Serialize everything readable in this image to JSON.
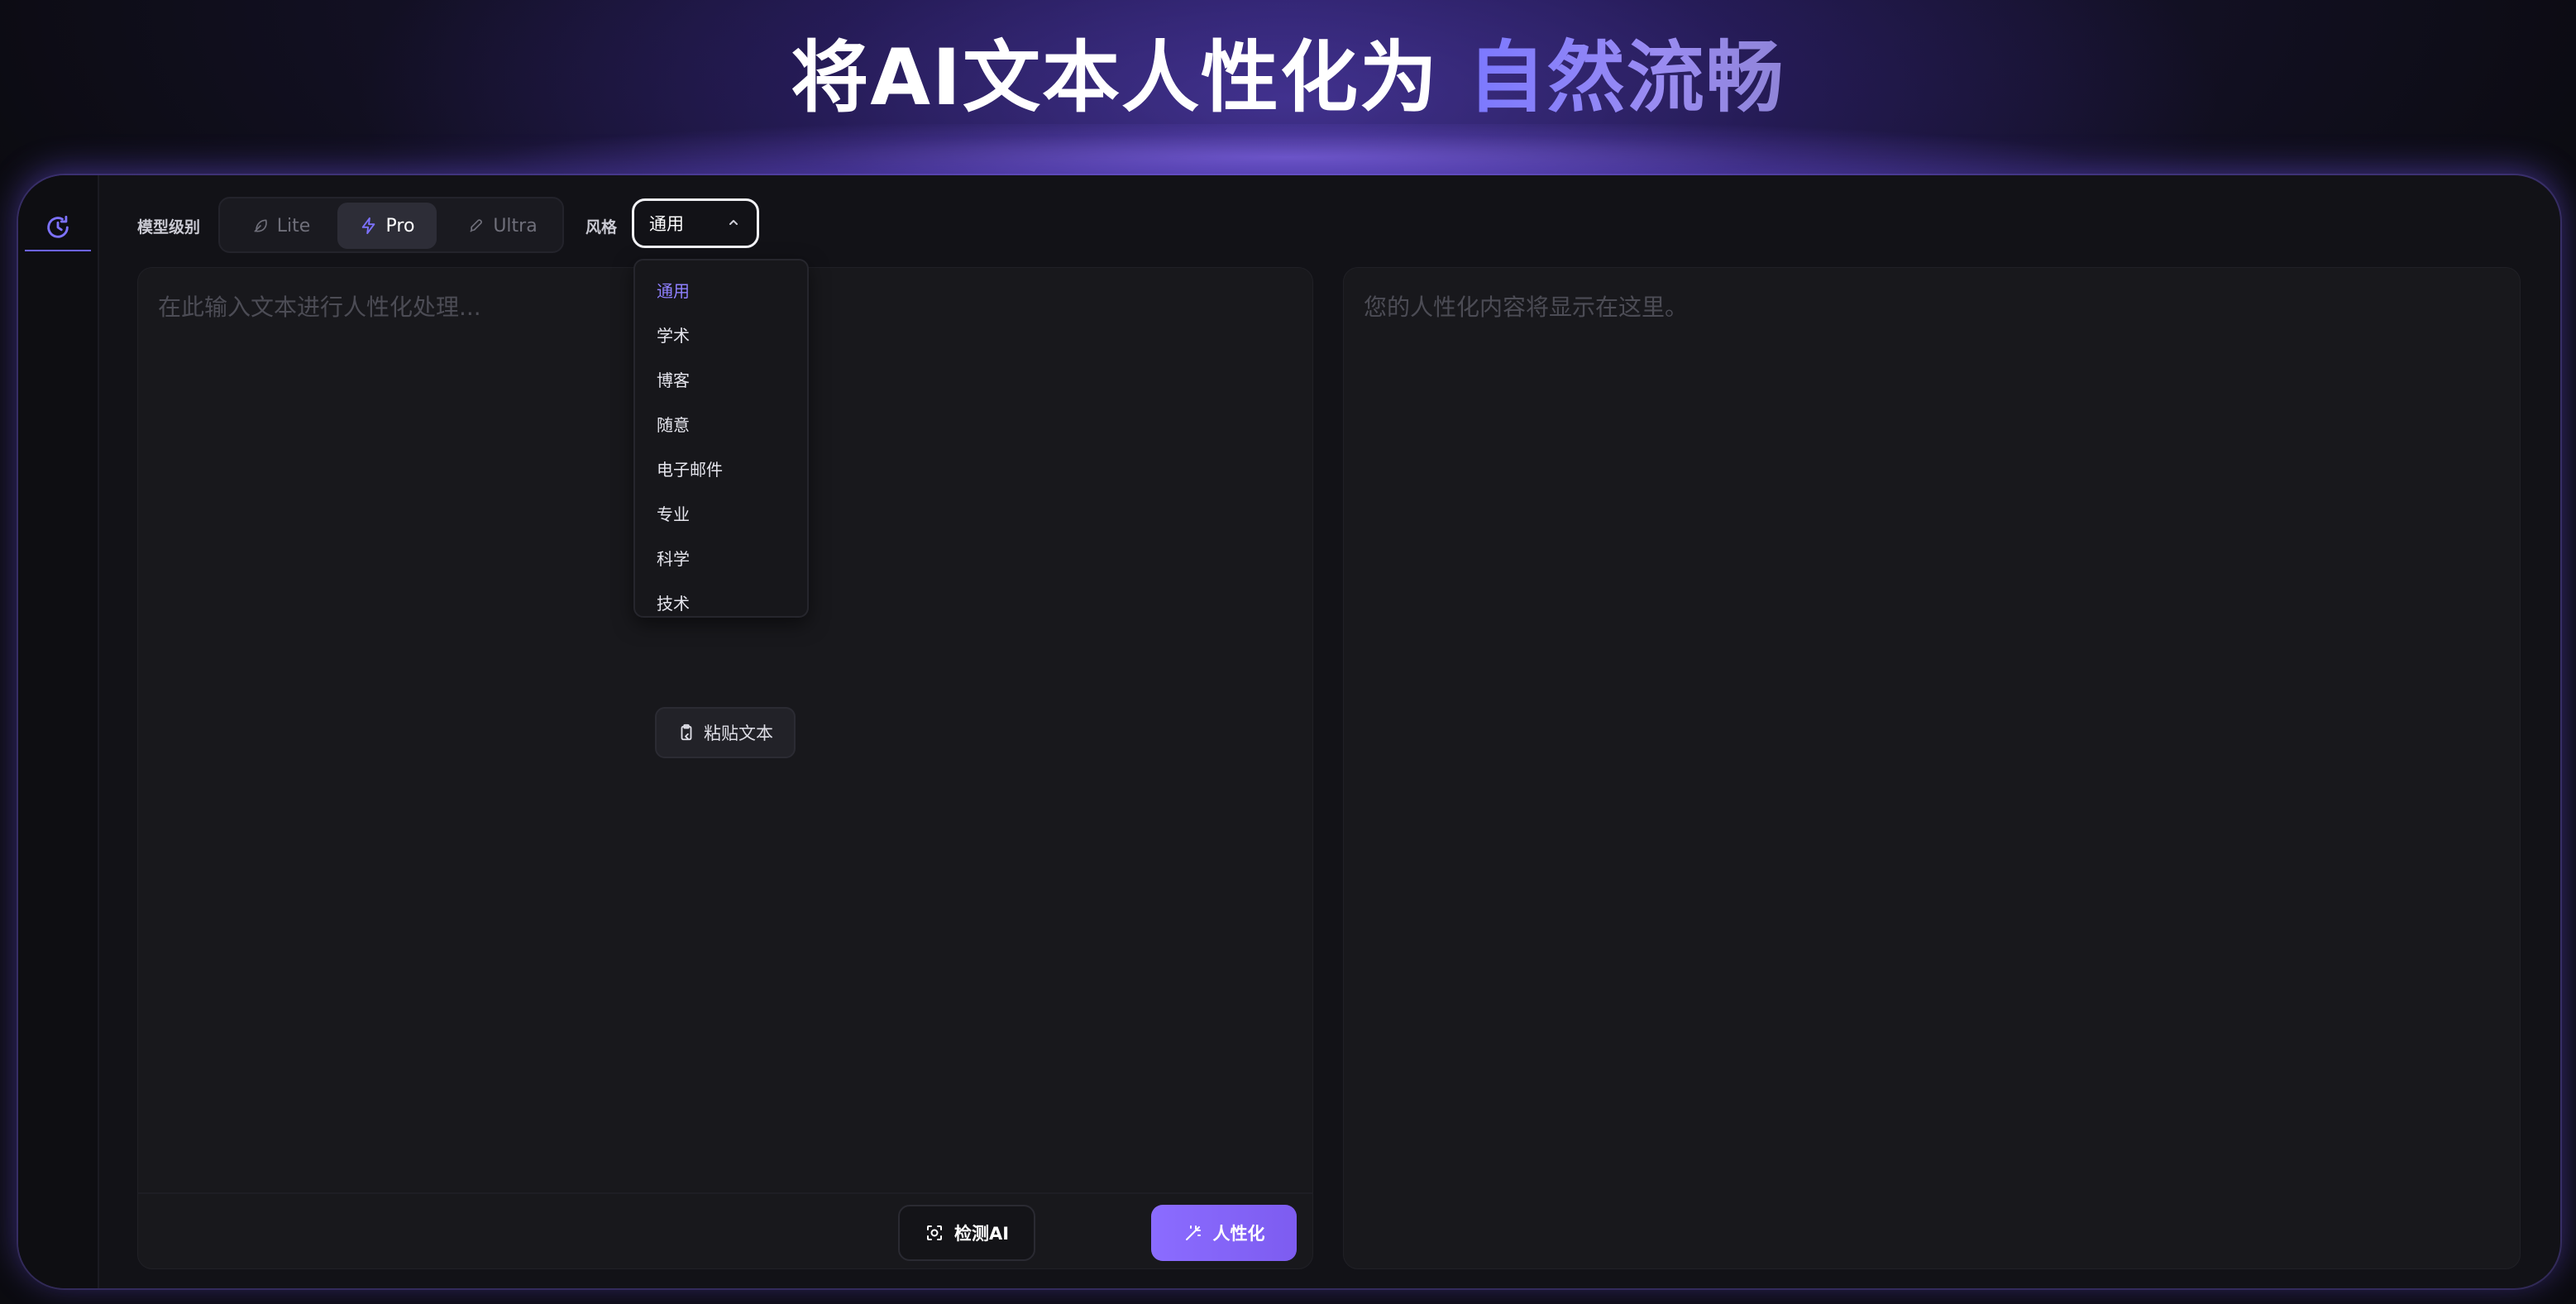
{
  "hero": {
    "title_main": "将AI文本人性化为 ",
    "title_accent": "自然流畅"
  },
  "toolbar": {
    "model_level_label": "模型级别",
    "tiers": [
      {
        "label": "Lite",
        "icon": "feather-icon",
        "active": false
      },
      {
        "label": "Pro",
        "icon": "lightning-icon",
        "active": true
      },
      {
        "label": "Ultra",
        "icon": "rocket-icon",
        "active": false
      }
    ],
    "style_label": "风格",
    "style_selected": "通用"
  },
  "style_dropdown": {
    "options": [
      "通用",
      "学术",
      "博客",
      "随意",
      "电子邮件",
      "专业",
      "科学",
      "技术"
    ],
    "selected_index": 0
  },
  "input_panel": {
    "placeholder": "在此输入文本进行人性化处理...",
    "paste_button": "粘贴文本",
    "detect_button": "检测AI",
    "humanize_button": "人性化"
  },
  "output_panel": {
    "placeholder": "您的人性化内容将显示在这里。"
  },
  "colors": {
    "accent": "#8b6cff",
    "accent_text": "#8f80ff",
    "background": "#0b0b10",
    "panel": "#18181c"
  }
}
